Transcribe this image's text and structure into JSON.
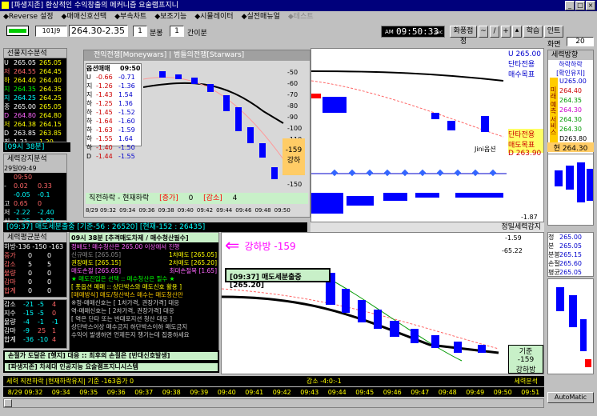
{
  "title": "[파생지존] 환상적인 수익창출의 메커니즘 요술램프지니",
  "menu": [
    "◆Reverse 설정",
    "◆매매신호선택",
    "◆부속차트",
    "◆보조기능",
    "◆시뮬레이터",
    "◆실전매뉴얼",
    "◆테스트"
  ],
  "toolbar": {
    "code": "101J9",
    "price": "264.30",
    "change": "-2.35",
    "period": "1",
    "period_unit": "분봉",
    "count": "1",
    "count_unit": "간이분",
    "clock_label": "AM",
    "clock": "09:50:33",
    "clock_unit": "sec",
    "buttons": [
      "화풍점정",
      "~",
      "/",
      "+",
      "학습",
      "인트"
    ],
    "screen_label": "화면",
    "screen_num": "20"
  },
  "left_panel": {
    "title": "선물지수분석",
    "rows": [
      [
        "U",
        "265.05",
        "265.05"
      ],
      [
        "저",
        "264.55",
        "264.45"
      ],
      [
        "하",
        "264.40",
        "264.40"
      ],
      [
        "지",
        "264.35",
        "264.35"
      ],
      [
        "지",
        "264.25",
        "264.25"
      ],
      [
        "종",
        "265.00",
        "265.05"
      ],
      [
        "D",
        "264.80",
        "264.80"
      ],
      [
        "저",
        "264.38",
        "264.15"
      ],
      [
        "D",
        "263.85",
        "263.85"
      ],
      [
        "최",
        "1.21",
        "1.20"
      ]
    ],
    "info": "[09시 38분]",
    "strength_title": "세력강지분석",
    "strength_time": "29일09:49",
    "strength_vals": [
      [
        "",
        "09:50"
      ],
      [
        "-",
        "0.02",
        "0.33"
      ],
      [
        "",
        "-0.05",
        "-0.1"
      ],
      [
        "고",
        "0.65",
        "0"
      ],
      [
        "저",
        "-2.22",
        "-2.40"
      ],
      [
        "시",
        "-1.25",
        "-1.87"
      ],
      [
        "지",
        "-2.38",
        "-1.11"
      ]
    ],
    "avg_title": "세력평균분석",
    "avg_sub": "하방-136 -150 -163",
    "avg_rows": [
      [
        "증가",
        "0",
        "0"
      ],
      [
        "감소",
        "5",
        "5"
      ],
      [
        "물량",
        "0",
        "0"
      ],
      [
        "감마",
        "0",
        "0"
      ],
      [
        "합계",
        "0",
        "0"
      ]
    ],
    "stat_rows": [
      [
        "감소",
        "-21",
        "-5",
        "4"
      ],
      [
        "지수",
        "-15",
        "-5",
        "0"
      ],
      [
        "물량",
        "-4",
        "-1",
        "-1"
      ],
      [
        "감마",
        "-9",
        "25",
        "1"
      ],
      [
        "합계",
        "-36",
        "-10",
        "4"
      ]
    ]
  },
  "popup": {
    "title": "전익전쟁[Moneywars] | 범들의전쟁[Starwars]",
    "opt_title": "옵션매매",
    "opt_time": "09:50",
    "opt_rows": [
      [
        "U",
        "-0.66",
        "-0.71"
      ],
      [
        "지",
        "-1.26",
        "-1.36"
      ],
      [
        "지",
        "-1.43",
        "1.54"
      ],
      [
        "하",
        "-1.25",
        "1.36"
      ],
      [
        "하",
        "-1.45",
        "-1.52"
      ],
      [
        "하",
        "-1.64",
        "-1.60"
      ],
      [
        "하",
        "-1.63",
        "-1.59"
      ],
      [
        "하",
        "-1.55",
        "1.64"
      ],
      [
        "하",
        "-1.40",
        "-1.50"
      ],
      [
        "D",
        "-1.44",
        "-1.55"
      ]
    ],
    "yticks": [
      "-50",
      "-60",
      "-70",
      "-80",
      "-90",
      "-100",
      "-110",
      "-120",
      "-130",
      "-140",
      "-150",
      "-160"
    ],
    "side_label": "-159",
    "side_label2": "강하",
    "status": "직전하락 - 현재하락",
    "status2": "[증가]",
    "status3": "0",
    "status4": "[감소]",
    "status5": "4",
    "times": [
      "8/29 09:32",
      "09:34",
      "09:36",
      "09:38",
      "09:40",
      "09:42",
      "09:44",
      "09:46",
      "09:48",
      "09:50"
    ]
  },
  "upper_right": {
    "u_label": "U 265.00",
    "label1": "단타전용",
    "label2": "매수목표",
    "label3": "단타전용",
    "label4": "매도목표",
    "d_label": "D 263.90",
    "jini": "Jini옵션",
    "val1": "-1.87"
  },
  "side": {
    "title": "세력방향",
    "sub": "하락하락",
    "sub2": "[확인유지]",
    "vals": [
      "U265.00",
      "264.40",
      "264.35",
      "264.30",
      "264.30",
      "264.30",
      "D263.80"
    ],
    "vertical": "미래 예측 서비스",
    "price": "264.30",
    "label_cur": "현"
  },
  "middle_bar": "[09:37] 매도세분출중 [기준-56 : 26520] [현재-152 : 26435]",
  "right_bar": "정밀세력감지",
  "main_box": {
    "title": "09시 38분 [추격매도차제 / 매수청산필수]",
    "l1": "정배도! 매수청산은 265.00 이상에서 진행",
    "l2": "신규매도 [265.05]",
    "l3": "1차매도 [265.05]",
    "l4": "권장매도 [265.15]",
    "l5": "2차매도 [265.20]",
    "l6": "매도손절 [265.65]",
    "l7": "최대손절목 [1.65]",
    "l8": "★ 매도진입은 선택 :: 매수청산은 필수 ★",
    "l9": "[ 풋옵션 매매 :: 상단박스와 매도신호 활용 ]",
    "l10": "[매매방식] 매도/청산박스 매수는 매도청산만",
    "l11": "※정-매매신호는 [ 1차가격, 권장가격] 대응",
    "l12": "역-매매신호는 [ 2차가격, 권장가격] 대응",
    "l13": "[ 역은 단타 또는 반대포지션 청산 대응 ]",
    "l14": "상단박스이상 매수금지 하단박스이하 매도금지",
    "l15": "수익이 발생하면 언제든지 챙기는데 집중하세요",
    "footer1": "손절가 도달은 [헷지] 대응 :: 최후의 손절은 [반대신호발생]",
    "footer2": "[파생지존] 차세대 인공지능 요술램프지니시스템"
  },
  "pink_label": "강하방 -159",
  "green_label": "[09:37] 매도세분출중[265.20]",
  "lower_right": {
    "v1": "-1.59",
    "v2": "-65.22",
    "b1": "기준",
    "b2": "-159",
    "b3": "강하방"
  },
  "lower_side": {
    "rows": [
      [
        "정",
        "265.00"
      ],
      [
        "분",
        "265.05"
      ],
      [
        "분봉",
        "265.15"
      ],
      [
        "손절",
        "265.60"
      ],
      [
        "평균",
        "265.05"
      ]
    ]
  },
  "bottom_status": "세력 직전하락 |현재하락유지| 기준 -163중가 0",
  "bottom_status2": "감소 -4:0:-1",
  "bottom_status3": "세력분석",
  "times_bottom": [
    "8/29 09:32",
    "09:34",
    "09:35",
    "09:36",
    "09:37",
    "09:38",
    "09:39",
    "09:40",
    "09:41",
    "09:42",
    "09:43",
    "09:44",
    "09:45",
    "09:46",
    "09:47",
    "09:48",
    "09:49",
    "09:50",
    "09:51"
  ],
  "automatic": "AutoMatic",
  "colors": {
    "navy": "#00007b",
    "teal": "#008080",
    "red": "#ff0000",
    "blue": "#0000ff",
    "green": "#00ff00",
    "pink": "#ff00ff"
  }
}
